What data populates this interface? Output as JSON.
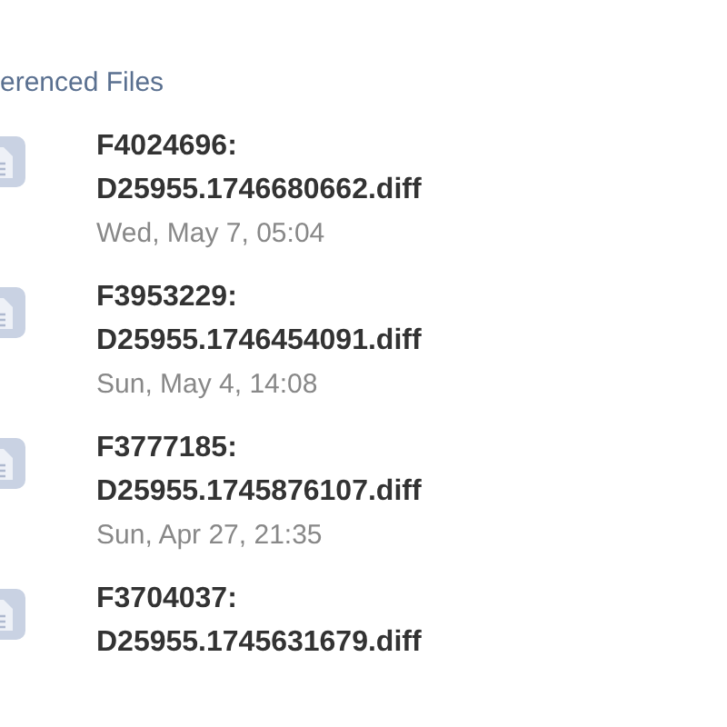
{
  "section": {
    "title": "erenced Files"
  },
  "files": [
    {
      "name": "F4024696:",
      "file": "D25955.1746680662.diff",
      "date": "Wed, May 7, 05:04"
    },
    {
      "name": "F3953229:",
      "file": "D25955.1746454091.diff",
      "date": "Sun, May 4, 14:08"
    },
    {
      "name": "F3777185:",
      "file": "D25955.1745876107.diff",
      "date": "Sun, Apr 27, 21:35"
    },
    {
      "name": "F3704037:",
      "file": "D25955.1745631679.diff"
    }
  ]
}
